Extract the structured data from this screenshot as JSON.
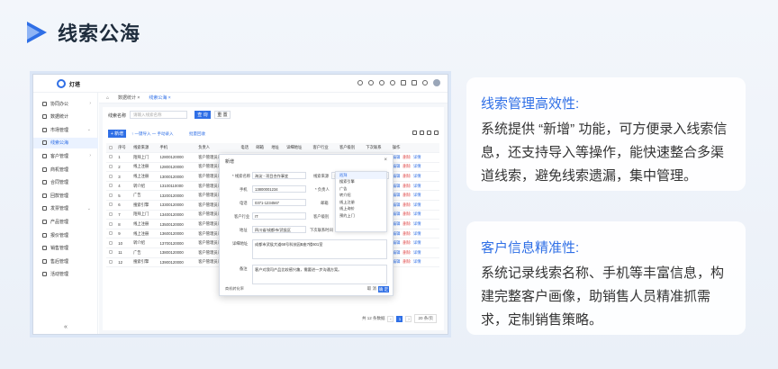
{
  "page": {
    "title": "线索公海",
    "accent": "#2f6fe6"
  },
  "app": {
    "logo_text": "灯塔",
    "sidebar": [
      {
        "label": "协同办公",
        "icon": "cloud-icon",
        "arrow": "›"
      },
      {
        "label": "数据统计",
        "icon": "home-icon",
        "arrow": ""
      },
      {
        "label": "市场管理",
        "icon": "megaphone-icon",
        "arrow": "⌄"
      },
      {
        "label": "线索公海",
        "icon": "list-icon",
        "arrow": "",
        "active": true
      },
      {
        "label": "客户管理",
        "icon": "user-icon",
        "arrow": "›"
      },
      {
        "label": "商机管理",
        "icon": "chart-icon",
        "arrow": ""
      },
      {
        "label": "合同管理",
        "icon": "document-icon",
        "arrow": ""
      },
      {
        "label": "回款管理",
        "icon": "money-icon",
        "arrow": ""
      },
      {
        "label": "发票管理",
        "icon": "invoice-icon",
        "arrow": "⌄"
      },
      {
        "label": "产品管理",
        "icon": "box-icon",
        "arrow": ""
      },
      {
        "label": "报价管理",
        "icon": "tag-icon",
        "arrow": ""
      },
      {
        "label": "销售管理",
        "icon": "cart-icon",
        "arrow": ""
      },
      {
        "label": "售后管理",
        "icon": "tool-icon",
        "arrow": ""
      },
      {
        "label": "活动管理",
        "icon": "calendar-icon",
        "arrow": ""
      }
    ],
    "collapse_label": "«",
    "tabs": [
      {
        "label": "⌂",
        "active": false
      },
      {
        "label": "数据统计 ×",
        "active": false
      },
      {
        "label": "线索公海 ×",
        "active": true
      }
    ],
    "search": {
      "label": "线索名称",
      "placeholder": "请输入线索名称",
      "query_btn": "查 询",
      "reset_btn": "重 置"
    },
    "toolbar": {
      "add_btn": "+ 新增",
      "import_link": "↑ 一键导入 一 手动录入",
      "bulk_link": "批量回收"
    },
    "table": {
      "headers": [
        "",
        "序号",
        "线索来源",
        "手机",
        "负责人",
        "电话",
        "邮箱",
        "地址",
        "详细地址",
        "客户行业",
        "客户级别",
        "下次联系",
        "操作"
      ],
      "rows": [
        [
          "1",
          "陌拜上门",
          "12800120000",
          "客户管理员系...",
          "02"
        ],
        [
          "2",
          "线上注册",
          "12800120000",
          "客户管理员系...",
          "02"
        ],
        [
          "3",
          "线上注册",
          "13000120000",
          "客户管理员系...",
          "02"
        ],
        [
          "4",
          "转介绍",
          "13100110000",
          "客户管理员系...",
          "02"
        ],
        [
          "5",
          "广告",
          "13200120000",
          "客户管理员系...",
          "02"
        ],
        [
          "6",
          "搜索引擎",
          "13300120000",
          "客户管理员系...",
          "02"
        ],
        [
          "7",
          "陌拜上门",
          "13400120000",
          "客户管理员系...",
          "02"
        ],
        [
          "8",
          "线上注册",
          "13500120000",
          "客户管理员系...",
          "02"
        ],
        [
          "9",
          "线上注册",
          "13600120000",
          "客户管理员系...",
          "02"
        ],
        [
          "10",
          "转介绍",
          "13700120000",
          "客户管理员系...",
          "02"
        ],
        [
          "11",
          "广告",
          "13800120000",
          "客户管理员系...",
          "02"
        ],
        [
          "12",
          "搜索引擎",
          "13900120000",
          "客户管理员系...",
          "02"
        ]
      ],
      "ops": {
        "edit": "编辑",
        "delete": "删除",
        "detail": "详情"
      }
    },
    "pager": {
      "total": "共 12 条数据",
      "current": "1",
      "size": "20 条/页"
    },
    "modal": {
      "title": "新增",
      "fields": {
        "name_label": "* 线索名称",
        "name_value": "海淀 - 项目合作事宜",
        "source_label": "线索来源",
        "source_value": "请选择",
        "mobile_label": "手机",
        "mobile_value": "13800001234",
        "owner_label": "* 负责人",
        "phone_label": "电话",
        "phone_value": "0371-1234567",
        "email_label": "邮箱",
        "industry_label": "客户行业",
        "industry_value": "IT",
        "level_label": "客户级别",
        "addr_label": "地址",
        "addr_value": "四川省/成都市/武侯区",
        "next_label": "下次联系时间",
        "detail_label": "详细地址",
        "detail_value": "成都市武侯大道68号科技园B座7楼601室",
        "remark_label": "备注",
        "remark_value": "客户对我司产品比较感兴趣，需要进一步沟通方案。"
      },
      "dropdown": [
        "陌拜",
        "搜索引擎",
        "广告",
        "转介绍",
        "线上注册",
        "线上询价",
        "预约上门"
      ],
      "footer_label": "商机转化率",
      "cancel": "取 消",
      "ok": "确 定"
    }
  },
  "features": [
    {
      "title": "线索管理高效性:",
      "body": "系统提供 “新增” 功能，可方便录入线索信息，还支持导入等操作，能快速整合多渠道线索，避免线索遗漏，集中管理。"
    },
    {
      "title": "客户信息精准性:",
      "body": "系统记录线索名称、手机等丰富信息，构建完整客户画像，助销售人员精准抓需求，定制销售策略。"
    }
  ]
}
